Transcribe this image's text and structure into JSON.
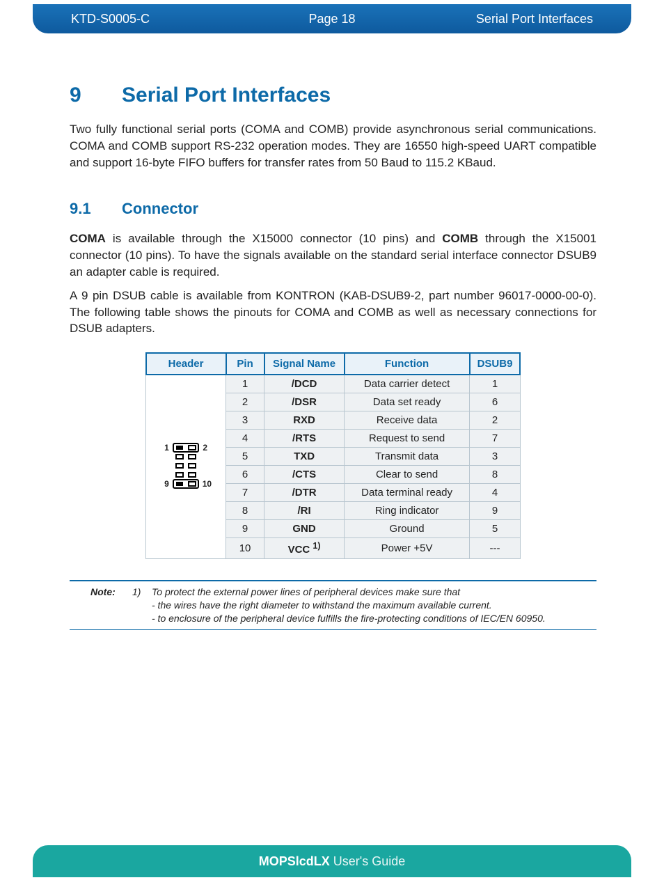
{
  "header": {
    "doc_id": "KTD-S0005-C",
    "page_label": "Page 18",
    "section_name": "Serial Port Interfaces"
  },
  "chapter": {
    "number": "9",
    "title": "Serial Port Interfaces",
    "intro": "Two fully functional serial ports (COMA and COMB) provide asynchronous serial communications. COMA and COMB support RS-232 operation modes. They are 16550 high-speed UART compatible and support 16-byte FIFO buffers for transfer rates from 50 Baud to 115.2 KBaud."
  },
  "section": {
    "number": "9.1",
    "title": "Connector",
    "para1_a": "COMA",
    "para1_b": " is available through the X15000 connector (10 pins) and ",
    "para1_c": "COMB",
    "para1_d": " through the X15001 connector (10 pins). To have the signals available on the standard serial interface connector DSUB9 an adapter cable is required.",
    "para2": "A 9 pin DSUB cable is available from KONTRON (KAB-DSUB9-2, part number 96017-0000-00-0). The following table shows the pinouts for COMA and COMB as well as necessary connections for DSUB adapters."
  },
  "table": {
    "headers": {
      "header": "Header",
      "pin": "Pin",
      "signal": "Signal Name",
      "function": "Function",
      "dsub": "DSUB9"
    },
    "diagram_labels": {
      "tl": "1",
      "tr": "2",
      "bl": "9",
      "br": "10"
    },
    "rows": [
      {
        "pin": "1",
        "signal": "/DCD",
        "function": "Data carrier detect",
        "dsub": "1"
      },
      {
        "pin": "2",
        "signal": "/DSR",
        "function": "Data set ready",
        "dsub": "6"
      },
      {
        "pin": "3",
        "signal": "RXD",
        "function": "Receive data",
        "dsub": "2"
      },
      {
        "pin": "4",
        "signal": "/RTS",
        "function": "Request to send",
        "dsub": "7"
      },
      {
        "pin": "5",
        "signal": "TXD",
        "function": "Transmit data",
        "dsub": "3"
      },
      {
        "pin": "6",
        "signal": "/CTS",
        "function": "Clear to send",
        "dsub": "8"
      },
      {
        "pin": "7",
        "signal": "/DTR",
        "function": "Data terminal ready",
        "dsub": "4"
      },
      {
        "pin": "8",
        "signal": "/RI",
        "function": "Ring indicator",
        "dsub": "9"
      },
      {
        "pin": "9",
        "signal": "GND",
        "function": "Ground",
        "dsub": "5"
      },
      {
        "pin": "10",
        "signal": "VCC 1)",
        "signal_main": "VCC ",
        "signal_sup": "1)",
        "function": "Power +5V",
        "dsub": "---"
      }
    ]
  },
  "note": {
    "label": "Note:",
    "num": "1)",
    "line1": "To protect the external power lines of peripheral devices make sure that",
    "line2": "- the wires have the right diameter to withstand the maximum available current.",
    "line3": "- to enclosure of the peripheral device fulfills the fire-protecting conditions of IEC/EN 60950."
  },
  "footer": {
    "bold": "MOPSlcdLX",
    "rest": " User's Guide"
  }
}
